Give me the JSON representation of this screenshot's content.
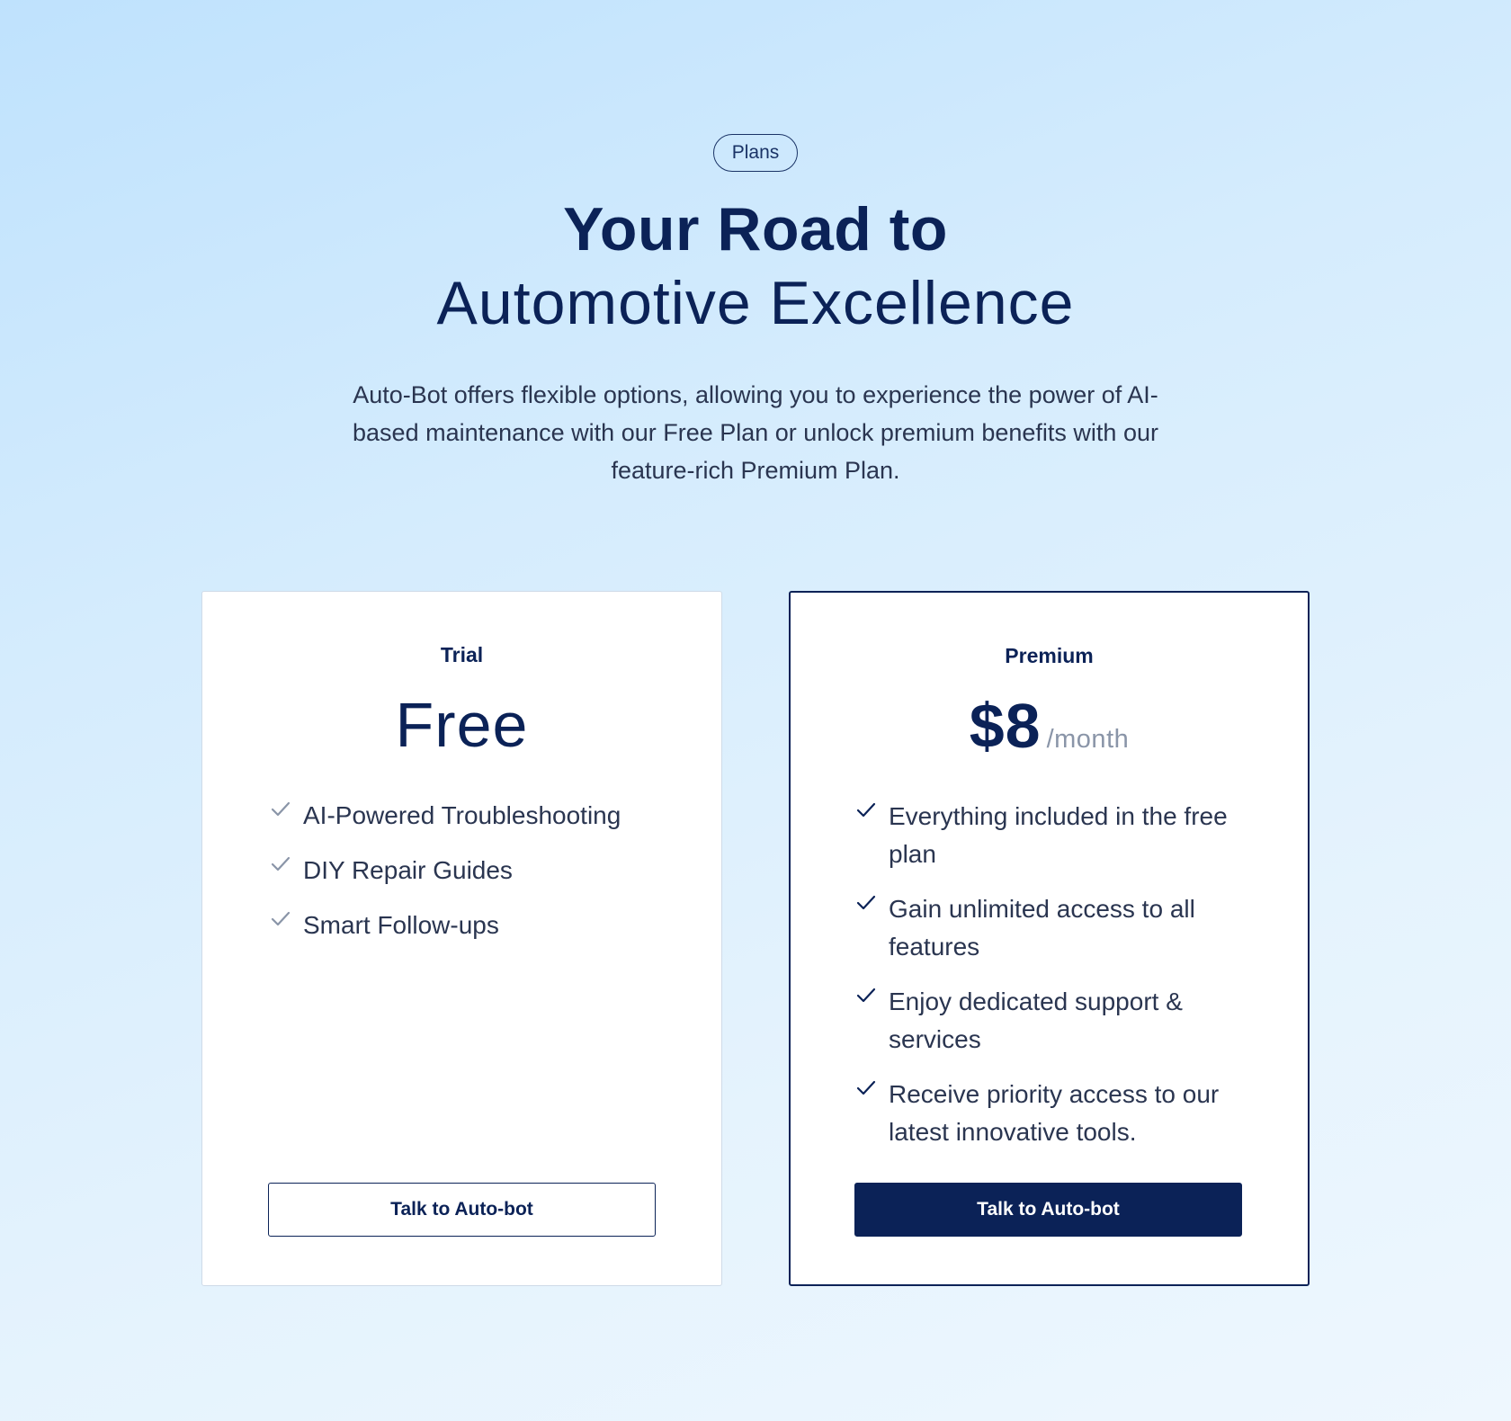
{
  "header": {
    "badge": "Plans",
    "title_line1": "Your Road to",
    "title_line2": "Automotive Excellence",
    "description": "Auto-Bot offers flexible options, allowing you to experience the power of AI-based maintenance with our Free Plan or unlock premium benefits with our feature-rich Premium Plan."
  },
  "plans": [
    {
      "name": "Trial",
      "price": "Free",
      "period": "",
      "features": [
        "AI-Powered Troubleshooting",
        "DIY Repair Guides",
        "Smart Follow-ups"
      ],
      "cta": "Talk to Auto-bot",
      "check_color": "#8a95a8"
    },
    {
      "name": "Premium",
      "price": "$8",
      "period": "/month",
      "features": [
        "Everything included in the free plan",
        "Gain unlimited access to all features",
        "Enjoy dedicated support & services",
        "Receive priority access to our latest innovative tools."
      ],
      "cta": "Talk to Auto-bot",
      "check_color": "#0b2257"
    }
  ],
  "icons": {
    "feature_icon": "check-icon"
  },
  "colors": {
    "brand_navy": "#0b2257",
    "text": "#2a3550",
    "muted": "#8a95a8"
  }
}
